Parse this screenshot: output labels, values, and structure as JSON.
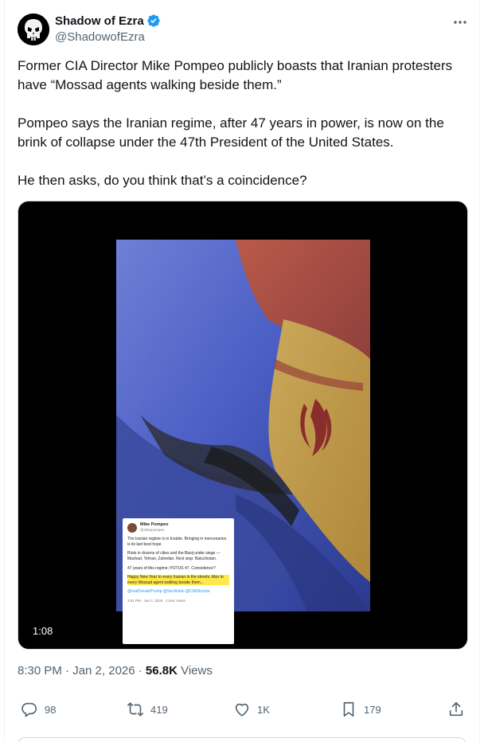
{
  "author": {
    "display_name": "Shadow of Ezra",
    "handle": "@ShadowofEzra",
    "verified": true,
    "verified_color": "#1d9bf0"
  },
  "tweet": {
    "paragraphs": [
      "Former CIA Director Mike Pompeo publicly boasts that Iranian protesters have “Mossad agents walking beside them.”",
      "Pompeo says the Iranian regime, after 47 years in power, is now on the brink of collapse under the 47th President of the United States.",
      "He then asks, do you think that’s a coincidence?"
    ]
  },
  "media": {
    "duration": "1:08",
    "embedded_post": {
      "name": "Mike Pompeo",
      "handle": "@mikepompeo",
      "p1": "The Iranian regime is in trouble. Bringing in mercenaries is its last best hope.",
      "p2": "Riots in dozens of cities and the Basij under siege — Mashad, Tehran, Zahedan. Next stop: Baluchistan.",
      "p3": "47 years of this regime; POTUS 47. Coincidence?",
      "p4": "Happy New Year to every Iranian in the streets. Also to every Mossad agent walking beside them...",
      "tags": "@realDonaldTrump @SecRubio @CIADirector",
      "meta": "3:51 PM · Jan 2, 2026 · 1,544 Views"
    }
  },
  "timestamp": {
    "time_date": "8:30 PM · Jan 2, 2026 · ",
    "views_count": "56.8K",
    "views_label": " Views"
  },
  "actions": {
    "replies": "98",
    "reposts": "419",
    "likes": "1K",
    "bookmarks": "179"
  },
  "icons": {
    "more": "more-horizontal-icon",
    "reply": "reply-icon",
    "repost": "repost-icon",
    "like": "heart-icon",
    "bookmark": "bookmark-icon",
    "share": "share-icon"
  }
}
